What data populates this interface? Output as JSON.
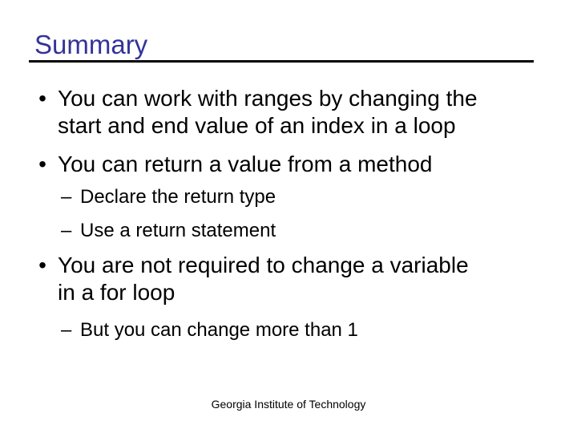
{
  "slide": {
    "title": "Summary",
    "title_color": "#333399",
    "bullets": [
      {
        "marker": "•",
        "text": "You can work with ranges by changing the start and end value of an index in a loop",
        "line1": "You can work with ranges by changing the",
        "line2": "start and end value of an index in a loop"
      },
      {
        "marker": "•",
        "text": "You can return a value from a method",
        "subitems": [
          {
            "marker": "–",
            "text": "Declare the return type"
          },
          {
            "marker": "–",
            "text": "Use a return statement"
          }
        ]
      },
      {
        "marker": "•",
        "text": "You are not required to change a variable in a for loop",
        "line1": "You are not required to change a variable",
        "line2": "in a for loop",
        "subitems": [
          {
            "marker": "–",
            "text": "But you can change more than 1"
          }
        ]
      }
    ],
    "footer": "Georgia Institute of Technology"
  }
}
